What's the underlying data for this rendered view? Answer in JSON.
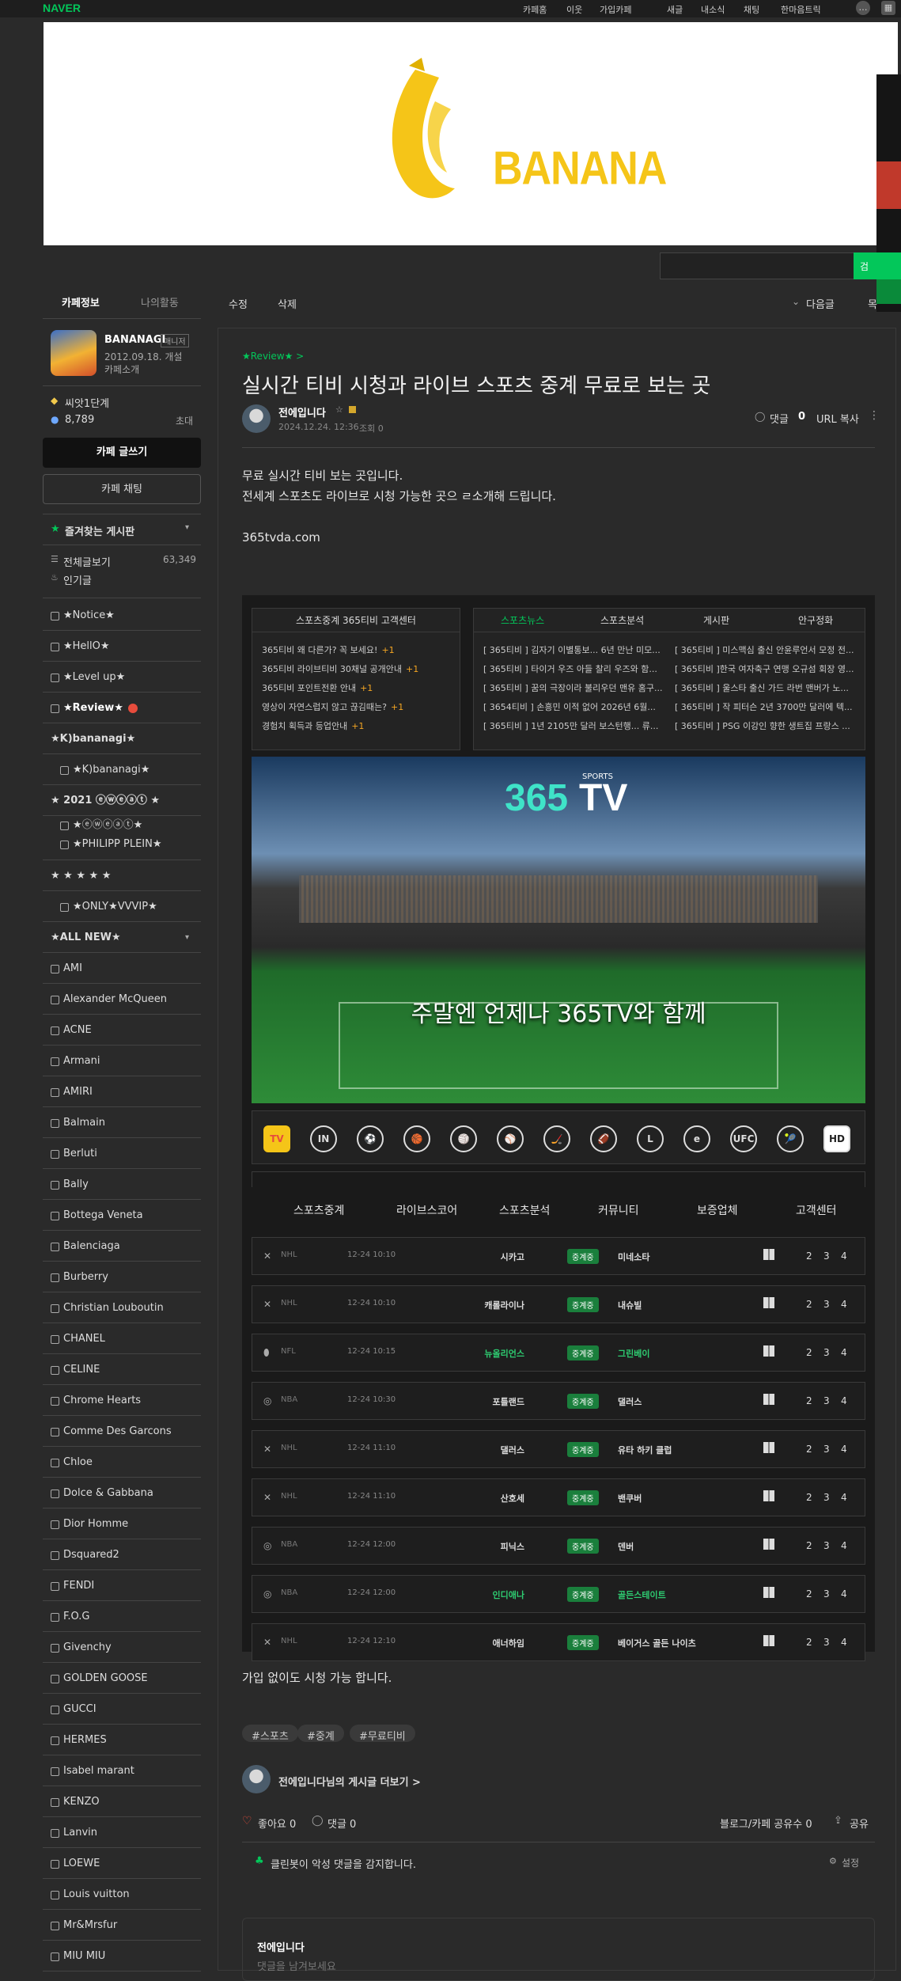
{
  "topbar": {
    "logo": "NAVER",
    "links": [
      "카페홈",
      "이웃",
      "가입카페",
      "새글",
      "내소식",
      "채팅",
      "한마음트릭"
    ]
  },
  "search": {
    "button": "검"
  },
  "sidebar": {
    "tabs": [
      "카페정보",
      "나의활동"
    ],
    "cafe_name": "BANANAGI",
    "manager_badge": "매니저",
    "founded": "2012.09.18. 개설",
    "intro": "카페소개",
    "level": "씨앗1단계",
    "members": "8,789",
    "invite": "초대",
    "write_btn": "카페 글쓰기",
    "chat_btn": "카페 채팅",
    "favorites": "즐겨찾는 게시판",
    "all_posts": "전체글보기",
    "all_count": "63,349",
    "popular": "인기글",
    "boards": [
      "★Notice★",
      "★HellO★",
      "★Level up★",
      "★Review★",
      "★K)bananagi★",
      "★K)bananagi★",
      "★ 2021 ⓔⓦⓔⓐⓣ ★",
      "★ⓔⓦⓔⓐⓣ★",
      "★PHILIPP PLEIN★",
      "★ ★ ★ ★ ★",
      "★ONLY★VVVIP★",
      "★ALL NEW★"
    ],
    "brands": [
      "AMI",
      "Alexander McQueen",
      "ACNE",
      "Armani",
      "AMIRI",
      "Balmain",
      "Berluti",
      "Bally",
      "Bottega Veneta",
      "Balenciaga",
      "Burberry",
      "Christian Louboutin",
      "CHANEL",
      "CELINE",
      "Chrome Hearts",
      "Comme Des Garcons",
      "Chloe",
      "Dolce & Gabbana",
      "Dior Homme",
      "Dsquared2",
      "FENDI",
      "F.O.G",
      "Givenchy",
      "GOLDEN GOOSE",
      "GUCCI",
      "HERMES",
      "Isabel marant",
      "KENZO",
      "Lanvin",
      "LOEWE",
      "Louis vuitton",
      "Mr&Mrsfur",
      "MIU MIU"
    ]
  },
  "actions": {
    "edit": "수정",
    "delete": "삭제",
    "next": "다음글",
    "list": "목"
  },
  "post": {
    "category": "★Review★ >",
    "title": "실시간 티비 시청과 라이브 스포츠 중계 무료로 보는 곳",
    "author": "전에입니다",
    "date": "2024.12.24. 12:36",
    "views": "조회 0",
    "comment_label": "댓글",
    "comment_count": "0",
    "url_copy": "URL 복사",
    "body1": "무료 실시간 티비 보는 곳입니다.",
    "body2": "전세계 스포츠도 라이브로 시청 가능한 곳으 ㄹ소개해 드립니다.",
    "site": "365tvda.com",
    "body3": "가입 없이도 시청 가능 합니다.",
    "tags": [
      "#스포츠",
      "#중계",
      "#무료티비"
    ],
    "more_by": "전에입니다님의 게시글 더보기 >",
    "like": "좋아요 0",
    "comment": "댓글 0",
    "share_count": "블로그/카페 공유수 0",
    "share": "공유",
    "cleanbot": "클린봇이 악성 댓글을 감지합니다.",
    "settings": "설정",
    "comment_author": "전에입니다",
    "comment_placeholder": "댓글을 남겨보세요"
  },
  "ad": {
    "center_title": "스포츠중계 365티비 고객센터",
    "center_lines": [
      "365티비 왜 다른가? 꼭 보세요!",
      "365티비 라이브티비 30채널 공개안내",
      "365티비 포인트전환 안내",
      "영상이 자연스럽지 않고 끊김때는?",
      "경험치 획득과 등업안내"
    ],
    "plus": "+1",
    "news_tabs": [
      "스포츠뉴스",
      "스포츠분석",
      "게시판",
      "안구정화"
    ],
    "news_left": [
      "[ 365티비 ] 김자기 이별통보... 6년 만난 미모...",
      "[ 365티비 ] 타이거 우즈 아들 찰리 우즈와 함...",
      "[ 365티비 ] 꿈의 극장이라 불리우던 맨유 홈구...",
      "[ 3654티비 ] 손흥민 이적 없어 2026년 6월...",
      "[ 365티비 ] 1년 2105만 달러 보스턴행... 류..."
    ],
    "news_right": [
      "[ 365티비 ] 미스맥심 출신 안윤루언서 모정 전...",
      "[ 365티비 ]한국 여자축구 연맹 오규섬 회장 영...",
      "[ 365티비 ] 울스타 출신 가드 라번 맨버가 노...",
      "[ 365티비 ] 작 피터슨 2년 3700만 달러에 텍...",
      "[ 365티비 ] PSG 이강인 향한 생트집 프랑스 ..."
    ],
    "logo_num": "365",
    "logo_tv": "TV",
    "logo_sports": "SPORTS",
    "slogan": "주말엔 언제나 365TV와 함께",
    "icons": [
      "TV",
      "IN",
      "⚽",
      "🏀",
      "🏐",
      "⚾",
      "🏒",
      "🏈",
      "L",
      "e",
      "UFC",
      "🎾",
      "HD"
    ],
    "nav": [
      "스포츠중계",
      "라이브스코어",
      "스포츠분석",
      "커뮤니티",
      "보증업체",
      "고객센터"
    ],
    "status": "중계중",
    "rows": [
      {
        "league": "NHL",
        "time": "12-24 10:10",
        "home": "시카고",
        "away": "미네소타",
        "hl": false
      },
      {
        "league": "NHL",
        "time": "12-24 10:10",
        "home": "캐롤라이나",
        "away": "내슈빌",
        "hl": false
      },
      {
        "league": "NFL",
        "time": "12-24 10:15",
        "home": "뉴올리언스",
        "away": "그린베이",
        "hl": true
      },
      {
        "league": "NBA",
        "time": "12-24 10:30",
        "home": "포틀랜드",
        "away": "댈러스",
        "hl": false
      },
      {
        "league": "NHL",
        "time": "12-24 11:10",
        "home": "댈러스",
        "away": "유타 하키 클럽",
        "hl": false
      },
      {
        "league": "NHL",
        "time": "12-24 11:10",
        "home": "산호세",
        "away": "밴쿠버",
        "hl": false
      },
      {
        "league": "NBA",
        "time": "12-24 12:00",
        "home": "피닉스",
        "away": "덴버",
        "hl": false
      },
      {
        "league": "NBA",
        "time": "12-24 12:00",
        "home": "인디애나",
        "away": "골든스테이트",
        "hl": true
      },
      {
        "league": "NHL",
        "time": "12-24 12:10",
        "home": "애너하임",
        "away": "베이거스 골든 나이츠",
        "hl": false
      }
    ],
    "nums": [
      "2",
      "3",
      "4"
    ]
  },
  "banner": {
    "brand": "BANANA"
  },
  "colors": {
    "accent": "#03c75a",
    "bg": "#2a2a2a",
    "banana": "#f5c518"
  }
}
